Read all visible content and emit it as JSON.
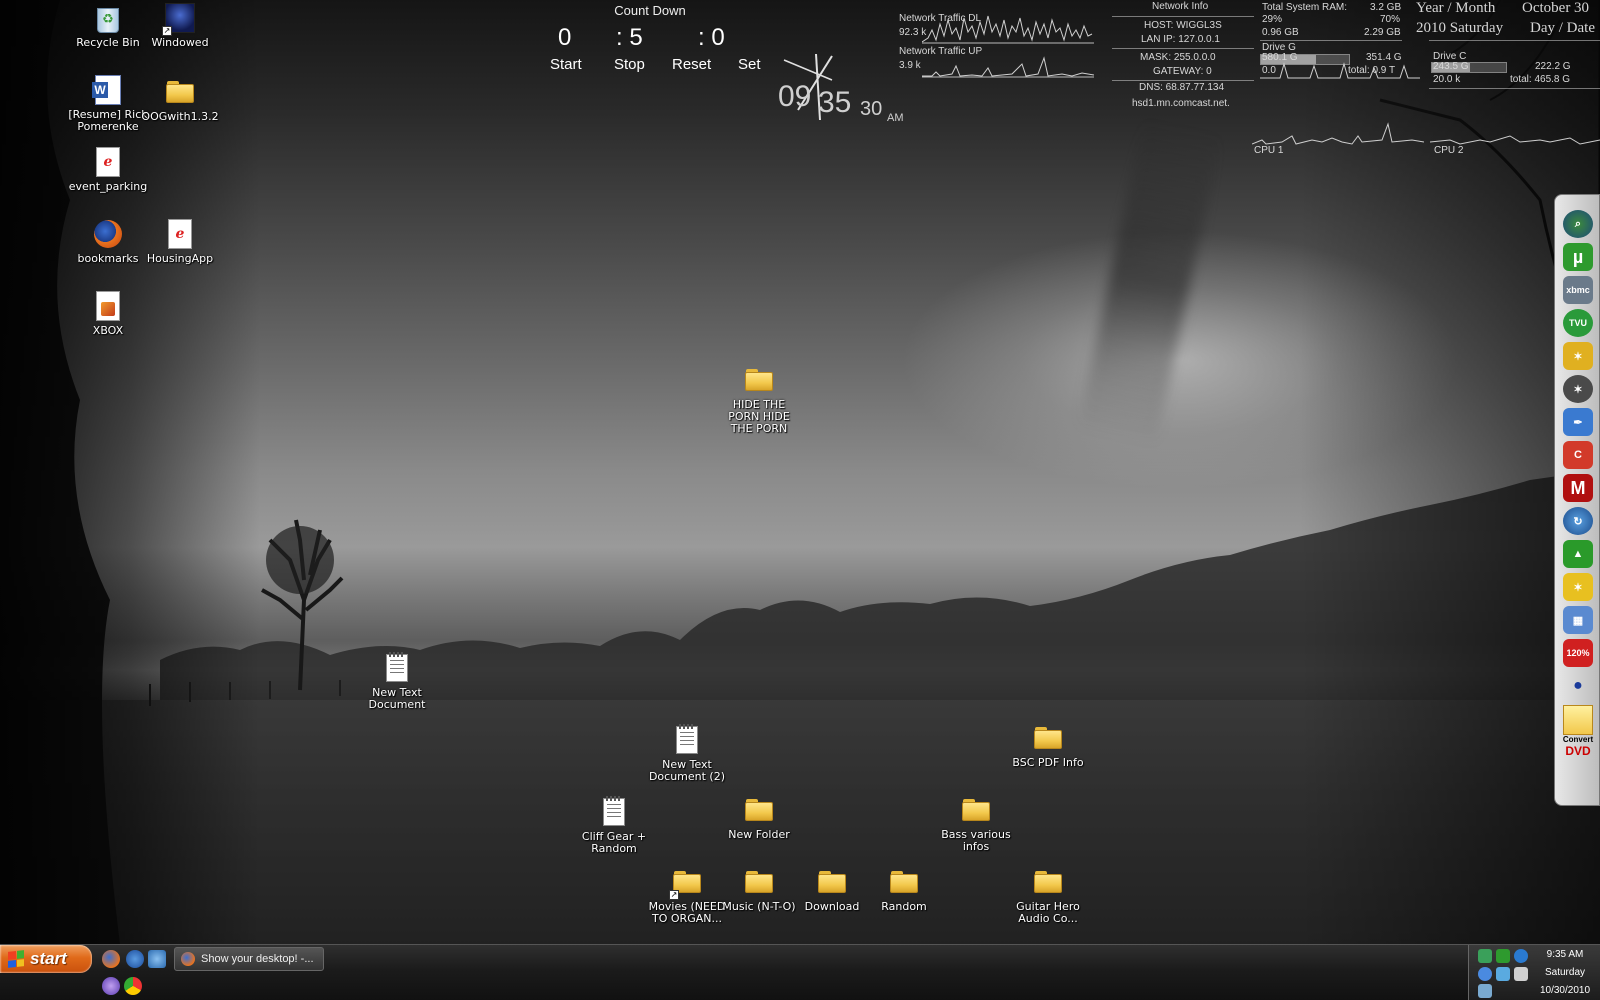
{
  "desktop_icons": {
    "recycle_bin": "Recycle Bin",
    "windowed": "Windowed",
    "resume": "[Resume] Rick Pomerenke",
    "oogwith": "OOGwith1.3.2",
    "event_parking": "event_parking",
    "bookmarks": "bookmarks",
    "housingapp": "HousingApp",
    "xbox": "XBOX",
    "hide_folder": "HIDE THE PORN HIDE THE PORN",
    "new_text_doc": "New Text Document",
    "new_text_doc2": "New Text Document (2)",
    "bsc_pdf": "BSC PDF Info",
    "cliff_gear": "Cliff Gear + Random",
    "new_folder": "New Folder",
    "bass_infos": "Bass various infos",
    "movies": "Movies (NEED TO ORGAN...",
    "music": "Music (N-T-O)",
    "download": "Download",
    "random": "Random",
    "guitar_hero": "Guitar Hero Audio Co..."
  },
  "countdown": {
    "title": "Count Down",
    "d1": "0",
    "d2": ": 5",
    "d3": ": 0",
    "start": "Start",
    "stop": "Stop",
    "reset": "Reset",
    "set": "Set"
  },
  "clock": {
    "hour": "09",
    "minute": "35",
    "second": "30",
    "ampm": "AM"
  },
  "network_traffic": {
    "dl_label": "Network Traffic DL",
    "dl_value": "92.3 k",
    "up_label": "Network Traffic UP",
    "up_value": "3.9 k"
  },
  "network_info": {
    "title": "Network Info",
    "host": "HOST: WIGGL3S",
    "lan_ip": "LAN IP: 127.0.0.1",
    "mask": "MASK: 255.0.0.0",
    "gateway": "GATEWAY: 0",
    "dns": "DNS: 68.87.77.134",
    "domain": "hsd1.mn.comcast.net."
  },
  "system": {
    "ram_label": "Total System RAM:",
    "ram_total": "3.2 GB",
    "ram_pct_left": "29%",
    "ram_pct_right": "70%",
    "ram_used": "0.96 GB",
    "ram_free": "2.29 GB",
    "ram_fraction": 0.29,
    "drive_g_label": "Drive G",
    "drive_g_used": "580.1 G",
    "drive_g_free": "351.4 G",
    "drive_g_small": "0.0",
    "drive_g_total": "total: 0.9 T",
    "drive_g_fraction": 0.62,
    "drive_c_label": "Drive C",
    "drive_c_used": "243.5 G",
    "drive_c_free": "222.2 G",
    "drive_c_small": "20.0 k",
    "drive_c_total": "total: 465.8 G",
    "drive_c_fraction": 0.52,
    "cpu1": "CPU 1",
    "cpu2": "CPU 2"
  },
  "date": {
    "year_month_label": "Year / Month",
    "month_day": "October 30",
    "year_weekday": "2010 Saturday",
    "day_date_label": "Day / Date"
  },
  "dock": {
    "items": [
      "search-globe",
      "utorrent",
      "xbmc",
      "tvu",
      "game-tool",
      "game-tool-dark",
      "feather",
      "ccleaner",
      "m",
      "globe-refresh",
      "chart",
      "game-tool-yellow",
      "window-app",
      "zoom",
      "dot",
      "convert-dvd"
    ],
    "utorrent_label": "µ",
    "xbmc_label": "xbmc",
    "tvu_label": "TVU",
    "m_label": "M",
    "zoom_label": "120%",
    "convert_label": "Convert",
    "dvd_label": "DVD"
  },
  "taskbar": {
    "start_label": "start",
    "task_firefox": "Show your desktop! -...",
    "tray_time": "9:35 AM",
    "tray_day": "Saturday",
    "tray_date": "10/30/2010"
  }
}
